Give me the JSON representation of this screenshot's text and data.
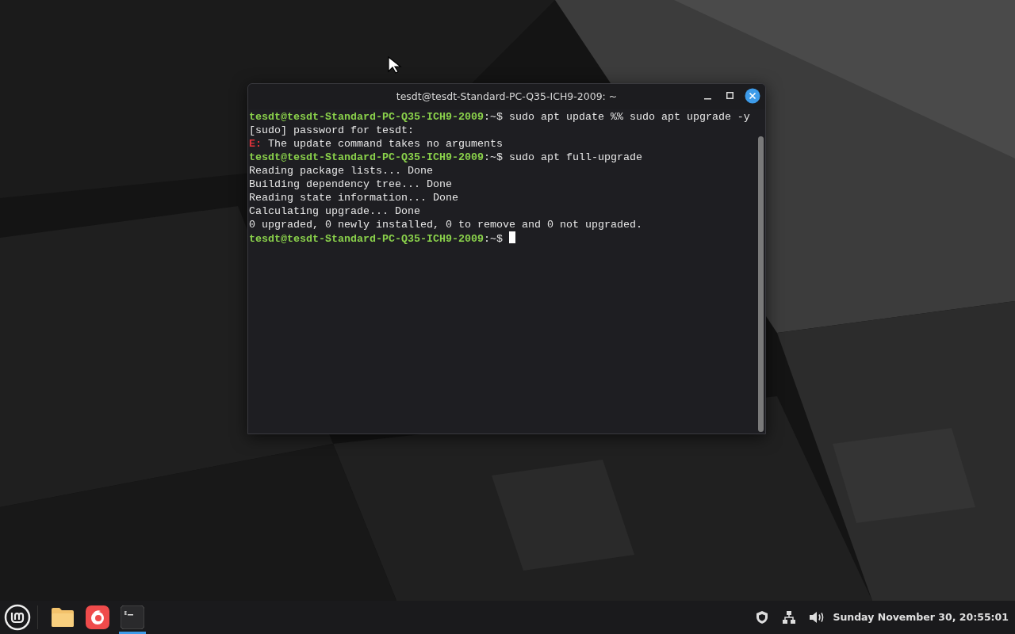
{
  "window": {
    "title": "tesdt@tesdt-Standard-PC-Q35-ICH9-2009: ~"
  },
  "terminal": {
    "lines": [
      {
        "kind": "prompt",
        "user_host": "tesdt@tesdt-Standard-PC-Q35-ICH9-2009",
        "path": ":~$",
        "command": "sudo apt update %% sudo apt upgrade -y"
      },
      {
        "kind": "output",
        "text": "[sudo] password for tesdt:"
      },
      {
        "kind": "error",
        "label": "E:",
        "text": "The update command takes no arguments"
      },
      {
        "kind": "prompt",
        "user_host": "tesdt@tesdt-Standard-PC-Q35-ICH9-2009",
        "path": ":~$",
        "command": "sudo apt full-upgrade"
      },
      {
        "kind": "output",
        "text": "Reading package lists... Done"
      },
      {
        "kind": "output",
        "text": "Building dependency tree... Done"
      },
      {
        "kind": "output",
        "text": "Reading state information... Done"
      },
      {
        "kind": "output",
        "text": "Calculating upgrade... Done"
      },
      {
        "kind": "output",
        "text": "0 upgraded, 0 newly installed, 0 to remove and 0 not upgraded."
      },
      {
        "kind": "prompt",
        "user_host": "tesdt@tesdt-Standard-PC-Q35-ICH9-2009",
        "path": ":~$",
        "cursor": true
      }
    ]
  },
  "taskbar": {
    "launchers": [
      {
        "kind": "files",
        "active": false
      },
      {
        "kind": "browser",
        "active": false
      },
      {
        "kind": "terminal",
        "active": true
      }
    ],
    "clock": "Sunday November 30, 20:55:01"
  }
}
